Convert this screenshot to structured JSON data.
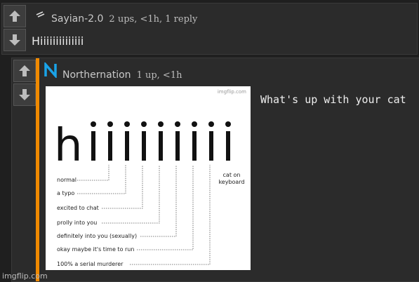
{
  "comment1": {
    "username": "Sayian-2.0",
    "meta": "2 ups, <1h, 1 reply",
    "text": "Hiiiiiiiiiiiiii"
  },
  "comment2": {
    "username": "Northernation",
    "meta": "1 up, <1h",
    "text": "What's up with your cat",
    "meme": {
      "watermark": "imgflip.com",
      "big_text": "hiiiiiiiii",
      "labels": [
        "normal",
        "a typo",
        "excited to chat",
        "prolly into you",
        "definitely into you (sexually)",
        "okay maybe it's time to run",
        "100% a serial murderer",
        "cat on keyboard"
      ]
    }
  },
  "watermark": "imgflip.com",
  "colors": {
    "accent_bar": "#f08a00",
    "avatar_blue": "#1aa3e8"
  }
}
